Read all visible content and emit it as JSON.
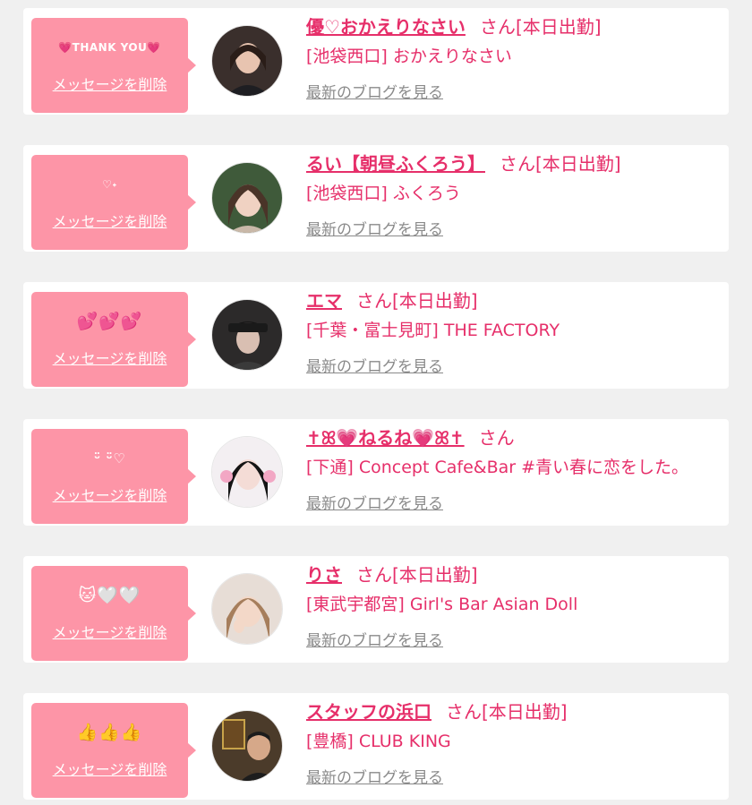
{
  "delete_label": "メッセージを削除",
  "blog_label": "最新のブログを見る",
  "san_label": "さん",
  "colors": {
    "accent": "#e62f6a",
    "bubble": "#fd95a7",
    "card": "#ffffff",
    "background": "#f0f0f0",
    "link_gray": "#8a8a8a"
  },
  "messages": [
    {
      "message": "💗THANK YOU💗",
      "name": "優♡おかえりなさい",
      "attendance": "[本日出勤]",
      "shop": "[池袋西口] おかえりなさい",
      "avatar_icon": "avatar-photo"
    },
    {
      "message": "♡˖",
      "name": "るい【朝昼ふくろう】",
      "attendance": "[本日出勤]",
      "shop": "[池袋西口] ふくろう",
      "avatar_icon": "avatar-photo"
    },
    {
      "message": "💕💕💕",
      "name": "エマ",
      "attendance": "[本日出勤]",
      "shop": "[千葉・富士見町] THE FACTORY",
      "avatar_icon": "avatar-photo"
    },
    {
      "message": "ᵕ̈  ᵕ̈♡",
      "name": "✝︎ꕤ💗ねるね💗ꕤ✝︎",
      "attendance": "",
      "shop": "[下通] Concept Cafe&Bar #青い春に恋をした。",
      "avatar_icon": "avatar-photo"
    },
    {
      "message": "🐱🤍🤍",
      "name": "りさ",
      "attendance": "[本日出勤]",
      "shop": "[東武宇都宮] Girl's Bar Asian Doll",
      "avatar_icon": "avatar-photo"
    },
    {
      "message": "👍👍👍",
      "name": "スタッフの浜口",
      "attendance": "[本日出勤]",
      "shop": "[豊橋] CLUB KING",
      "avatar_icon": "avatar-photo"
    }
  ]
}
